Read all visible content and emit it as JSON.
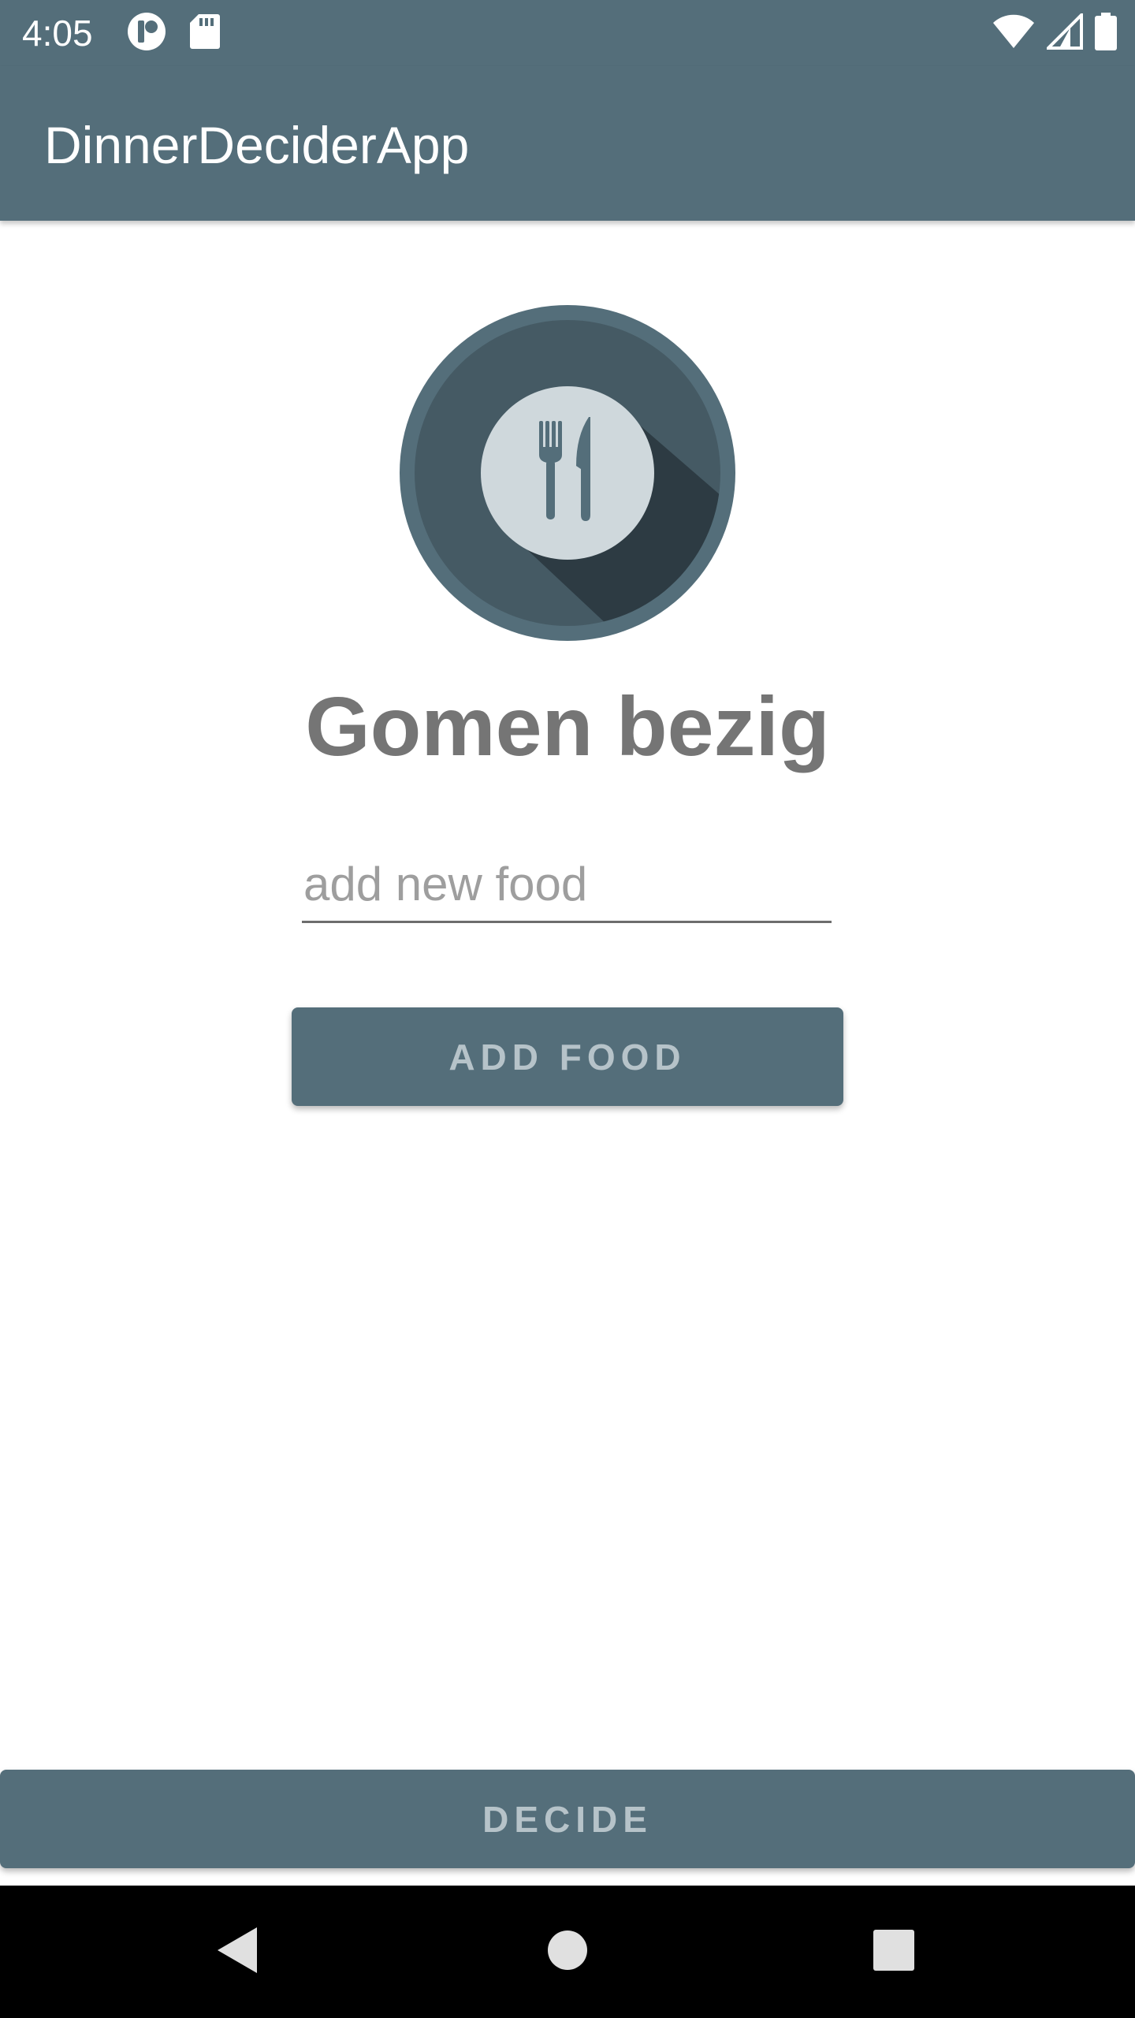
{
  "status_bar": {
    "time": "4:05",
    "left_icons": [
      "notification-app-icon",
      "sd-card-icon"
    ],
    "right_icons": [
      "wifi-icon",
      "cell-signal-icon",
      "battery-icon"
    ]
  },
  "app_bar": {
    "title": "DinnerDeciderApp"
  },
  "main": {
    "logo_icon": "plate-fork-knife-icon",
    "headline": "Gomen bezig",
    "food_input": {
      "value": "",
      "placeholder": "add new food"
    },
    "add_button_label": "ADD FOOD",
    "decide_button_label": "DECIDE"
  },
  "nav_bar": {
    "buttons": [
      "back-icon",
      "home-icon",
      "recents-icon"
    ]
  },
  "colors": {
    "primary": "#546e7a",
    "logo_outer": "#546e7a",
    "logo_inner": "#455a64",
    "logo_shadow": "#263238",
    "plate": "#cfd8dc",
    "headline_text": "#757575",
    "button_text": "#b6c3c9"
  }
}
